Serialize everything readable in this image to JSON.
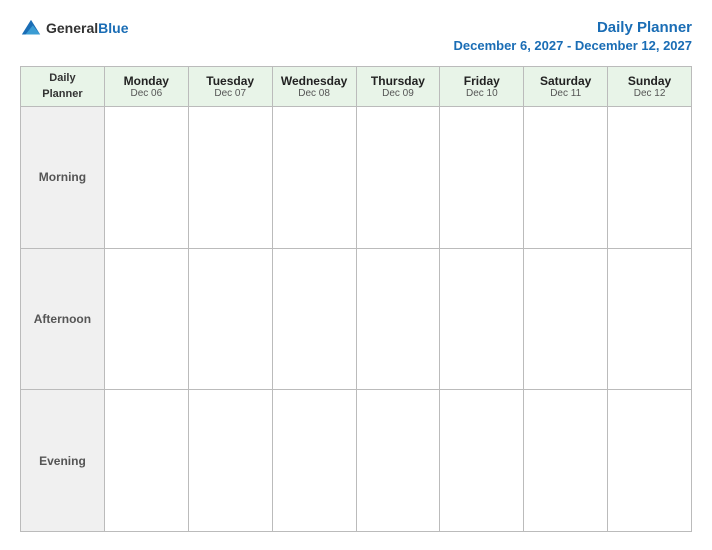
{
  "header": {
    "logo_general": "General",
    "logo_blue": "Blue",
    "planner_title": "Daily Planner",
    "date_range": "December 6, 2027 - December 12, 2027"
  },
  "table": {
    "label_col": {
      "header_line1": "Daily",
      "header_line2": "Planner"
    },
    "days": [
      {
        "name": "Monday",
        "date": "Dec 06"
      },
      {
        "name": "Tuesday",
        "date": "Dec 07"
      },
      {
        "name": "Wednesday",
        "date": "Dec 08"
      },
      {
        "name": "Thursday",
        "date": "Dec 09"
      },
      {
        "name": "Friday",
        "date": "Dec 10"
      },
      {
        "name": "Saturday",
        "date": "Dec 11"
      },
      {
        "name": "Sunday",
        "date": "Dec 12"
      }
    ],
    "rows": [
      {
        "label": "Morning"
      },
      {
        "label": "Afternoon"
      },
      {
        "label": "Evening"
      }
    ]
  }
}
